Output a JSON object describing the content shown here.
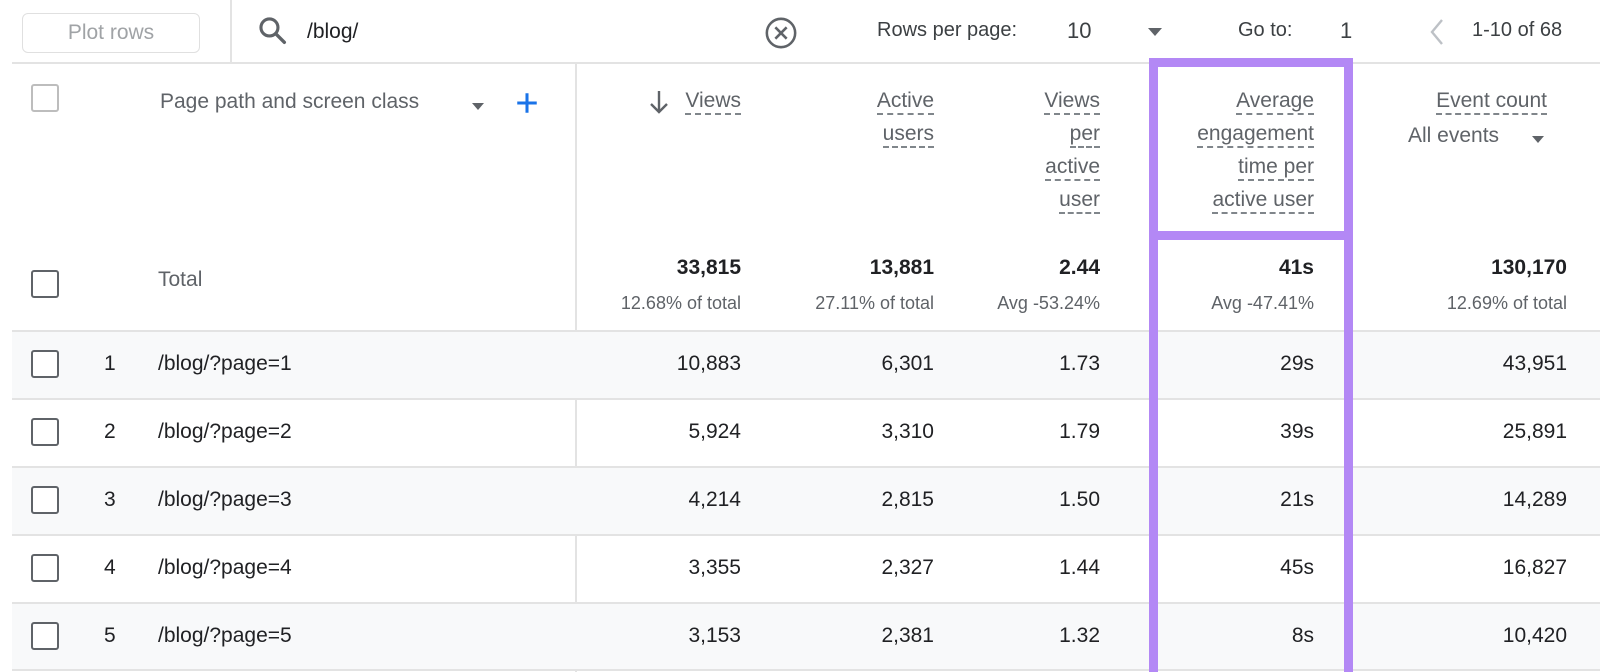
{
  "toolbar": {
    "plot_rows_label": "Plot rows",
    "search_value": "/blog/",
    "search_icon": "search-icon",
    "clear_icon": "clear-circle-x-icon",
    "rows_per_page_label": "Rows per page:",
    "rows_per_page_value": "10",
    "goto_label": "Go to:",
    "goto_value": "1",
    "prev_icon": "chevron-left-icon",
    "page_range": "1-10 of 68"
  },
  "table": {
    "dimension_header": "Page path and screen class",
    "add_icon": "plus-icon",
    "sort_icon": "arrow-down-icon",
    "columns": [
      {
        "key": "views",
        "label_lines": [
          "Views"
        ],
        "sorted": true
      },
      {
        "key": "active_users",
        "label_lines": [
          "Active",
          "users"
        ]
      },
      {
        "key": "views_per_user",
        "label_lines": [
          "Views",
          "per",
          "active",
          "user"
        ]
      },
      {
        "key": "avg_engagement",
        "label_lines": [
          "Average",
          "engagement",
          "time per",
          "active user"
        ],
        "highlighted": true
      },
      {
        "key": "event_count",
        "label_lines": [
          "Event count"
        ],
        "sub_select": "All events"
      }
    ],
    "total": {
      "label": "Total",
      "values": [
        "33,815",
        "13,881",
        "2.44",
        "41s",
        "130,170"
      ],
      "subs": [
        "12.68% of total",
        "27.11% of total",
        "Avg -53.24%",
        "Avg -47.41%",
        "12.69% of total"
      ]
    },
    "rows": [
      {
        "num": "1",
        "path": "/blog/?page=1",
        "values": [
          "10,883",
          "6,301",
          "1.73",
          "29s",
          "43,951"
        ]
      },
      {
        "num": "2",
        "path": "/blog/?page=2",
        "values": [
          "5,924",
          "3,310",
          "1.79",
          "39s",
          "25,891"
        ]
      },
      {
        "num": "3",
        "path": "/blog/?page=3",
        "values": [
          "4,214",
          "2,815",
          "1.50",
          "21s",
          "14,289"
        ]
      },
      {
        "num": "4",
        "path": "/blog/?page=4",
        "values": [
          "3,355",
          "2,327",
          "1.44",
          "45s",
          "16,827"
        ]
      },
      {
        "num": "5",
        "path": "/blog/?page=5",
        "values": [
          "3,153",
          "2,381",
          "1.32",
          "8s",
          "10,420"
        ]
      }
    ]
  },
  "highlight": {
    "color": "#b388f5",
    "column": "avg_engagement"
  },
  "colors": {
    "accent_blue": "#1a73e8",
    "row_alt": "#f8f9fa",
    "divider": "#e3e3e3"
  }
}
